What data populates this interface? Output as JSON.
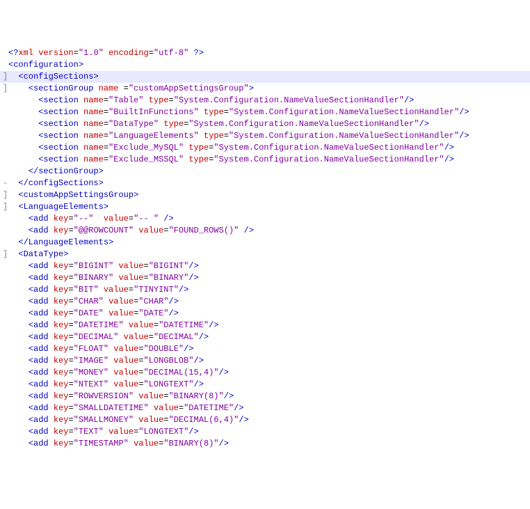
{
  "lines": [
    {
      "gutter": "",
      "indent": 0,
      "kind": "pi",
      "pi_name": "xml",
      "attrs": [
        [
          "version",
          "1.0"
        ],
        [
          "encoding",
          "utf-8"
        ]
      ]
    },
    {
      "gutter": "",
      "indent": 0,
      "kind": "open",
      "tag": "configuration"
    },
    {
      "gutter": "]",
      "indent": 1,
      "kind": "open",
      "tag": "configSections",
      "hl": true
    },
    {
      "gutter": "]",
      "indent": 2,
      "kind": "open",
      "tag": "sectionGroup",
      "attrs": [
        [
          "name",
          "customAppSettingsGroup"
        ],
        null
      ],
      "space_before_eq": true
    },
    {
      "gutter": "",
      "indent": 3,
      "kind": "selfclose",
      "tag": "section",
      "attrs": [
        [
          "name",
          "Table"
        ],
        [
          "type",
          "System.Configuration.NameValueSectionHandler"
        ]
      ]
    },
    {
      "gutter": "",
      "indent": 3,
      "kind": "selfclose",
      "tag": "section",
      "attrs": [
        [
          "name",
          "BuiltInFunctions"
        ],
        [
          "type",
          "System.Configuration.NameValueSectionHandler"
        ]
      ]
    },
    {
      "gutter": "",
      "indent": 3,
      "kind": "selfclose",
      "tag": "section",
      "attrs": [
        [
          "name",
          "DataType"
        ],
        [
          "type",
          "System.Configuration.NameValueSectionHandler"
        ]
      ]
    },
    {
      "gutter": "",
      "indent": 3,
      "kind": "selfclose",
      "tag": "section",
      "attrs": [
        [
          "name",
          "LanguageElements"
        ],
        [
          "type",
          "System.Configuration.NameValueSectionHandler"
        ]
      ]
    },
    {
      "gutter": "",
      "indent": 3,
      "kind": "selfclose",
      "tag": "section",
      "attrs": [
        [
          "name",
          "Exclude_MySQL"
        ],
        [
          "type",
          "System.Configuration.NameValueSectionHandler"
        ]
      ]
    },
    {
      "gutter": "",
      "indent": 3,
      "kind": "selfclose",
      "tag": "section",
      "attrs": [
        [
          "name",
          "Exclude_MSSQL"
        ],
        [
          "type",
          "System.Configuration.NameValueSectionHandler"
        ]
      ]
    },
    {
      "gutter": "",
      "indent": 2,
      "kind": "close",
      "tag": "sectionGroup"
    },
    {
      "gutter": "-",
      "indent": 1,
      "kind": "close",
      "tag": "configSections"
    },
    {
      "gutter": "]",
      "indent": 1,
      "kind": "open",
      "tag": "customAppSettingsGroup"
    },
    {
      "gutter": "]",
      "indent": 1,
      "kind": "open",
      "tag": "LanguageElements"
    },
    {
      "gutter": "",
      "indent": 2,
      "kind": "selfclose",
      "tag": "add",
      "attrs": [
        [
          "key",
          "--"
        ],
        [
          "value",
          "-- "
        ]
      ],
      "space_before_close": true,
      "value_gap": true
    },
    {
      "gutter": "",
      "indent": 2,
      "kind": "selfclose",
      "tag": "add",
      "attrs": [
        [
          "key",
          "@@ROWCOUNT"
        ],
        [
          "value",
          "FOUND_ROWS()"
        ]
      ],
      "space_before_close": true
    },
    {
      "gutter": "",
      "indent": 1,
      "kind": "close",
      "tag": "LanguageElements"
    },
    {
      "gutter": "]",
      "indent": 1,
      "kind": "open",
      "tag": "DataType"
    },
    {
      "gutter": "",
      "indent": 2,
      "kind": "selfclose",
      "tag": "add",
      "attrs": [
        [
          "key",
          "BIGINT"
        ],
        [
          "value",
          "BIGINT"
        ]
      ]
    },
    {
      "gutter": "",
      "indent": 2,
      "kind": "selfclose",
      "tag": "add",
      "attrs": [
        [
          "key",
          "BINARY"
        ],
        [
          "value",
          "BINARY"
        ]
      ]
    },
    {
      "gutter": "",
      "indent": 2,
      "kind": "selfclose",
      "tag": "add",
      "attrs": [
        [
          "key",
          "BIT"
        ],
        [
          "value",
          "TINYINT"
        ]
      ]
    },
    {
      "gutter": "",
      "indent": 2,
      "kind": "selfclose",
      "tag": "add",
      "attrs": [
        [
          "key",
          "CHAR"
        ],
        [
          "value",
          "CHAR"
        ]
      ]
    },
    {
      "gutter": "",
      "indent": 2,
      "kind": "selfclose",
      "tag": "add",
      "attrs": [
        [
          "key",
          "DATE"
        ],
        [
          "value",
          "DATE"
        ]
      ]
    },
    {
      "gutter": "",
      "indent": 2,
      "kind": "selfclose",
      "tag": "add",
      "attrs": [
        [
          "key",
          "DATETIME"
        ],
        [
          "value",
          "DATETIME"
        ]
      ]
    },
    {
      "gutter": "",
      "indent": 2,
      "kind": "selfclose",
      "tag": "add",
      "attrs": [
        [
          "key",
          "DECIMAL"
        ],
        [
          "value",
          "DECIMAL"
        ]
      ]
    },
    {
      "gutter": "",
      "indent": 2,
      "kind": "selfclose",
      "tag": "add",
      "attrs": [
        [
          "key",
          "FLOAT"
        ],
        [
          "value",
          "DOUBLE"
        ]
      ]
    },
    {
      "gutter": "",
      "indent": 2,
      "kind": "selfclose",
      "tag": "add",
      "attrs": [
        [
          "key",
          "IMAGE"
        ],
        [
          "value",
          "LONGBLOB"
        ]
      ]
    },
    {
      "gutter": "",
      "indent": 2,
      "kind": "selfclose",
      "tag": "add",
      "attrs": [
        [
          "key",
          "MONEY"
        ],
        [
          "value",
          "DECIMAL(15,4)"
        ]
      ]
    },
    {
      "gutter": "",
      "indent": 2,
      "kind": "selfclose",
      "tag": "add",
      "attrs": [
        [
          "key",
          "NTEXT"
        ],
        [
          "value",
          "LONGTEXT"
        ]
      ]
    },
    {
      "gutter": "",
      "indent": 2,
      "kind": "selfclose",
      "tag": "add",
      "attrs": [
        [
          "key",
          "ROWVERSION"
        ],
        [
          "value",
          "BINARY(8)"
        ]
      ]
    },
    {
      "gutter": "",
      "indent": 2,
      "kind": "selfclose",
      "tag": "add",
      "attrs": [
        [
          "key",
          "SMALLDATETIME"
        ],
        [
          "value",
          "DATETIME"
        ]
      ]
    },
    {
      "gutter": "",
      "indent": 2,
      "kind": "selfclose",
      "tag": "add",
      "attrs": [
        [
          "key",
          "SMALLMONEY"
        ],
        [
          "value",
          "DECIMAL(6,4)"
        ]
      ]
    },
    {
      "gutter": "",
      "indent": 2,
      "kind": "selfclose",
      "tag": "add",
      "attrs": [
        [
          "key",
          "TEXT"
        ],
        [
          "value",
          "LONGTEXT"
        ]
      ]
    },
    {
      "gutter": "",
      "indent": 2,
      "kind": "selfclose",
      "tag": "add",
      "attrs": [
        [
          "key",
          "TIMESTAMP"
        ],
        [
          "value",
          "BINARY(8)"
        ]
      ]
    }
  ]
}
